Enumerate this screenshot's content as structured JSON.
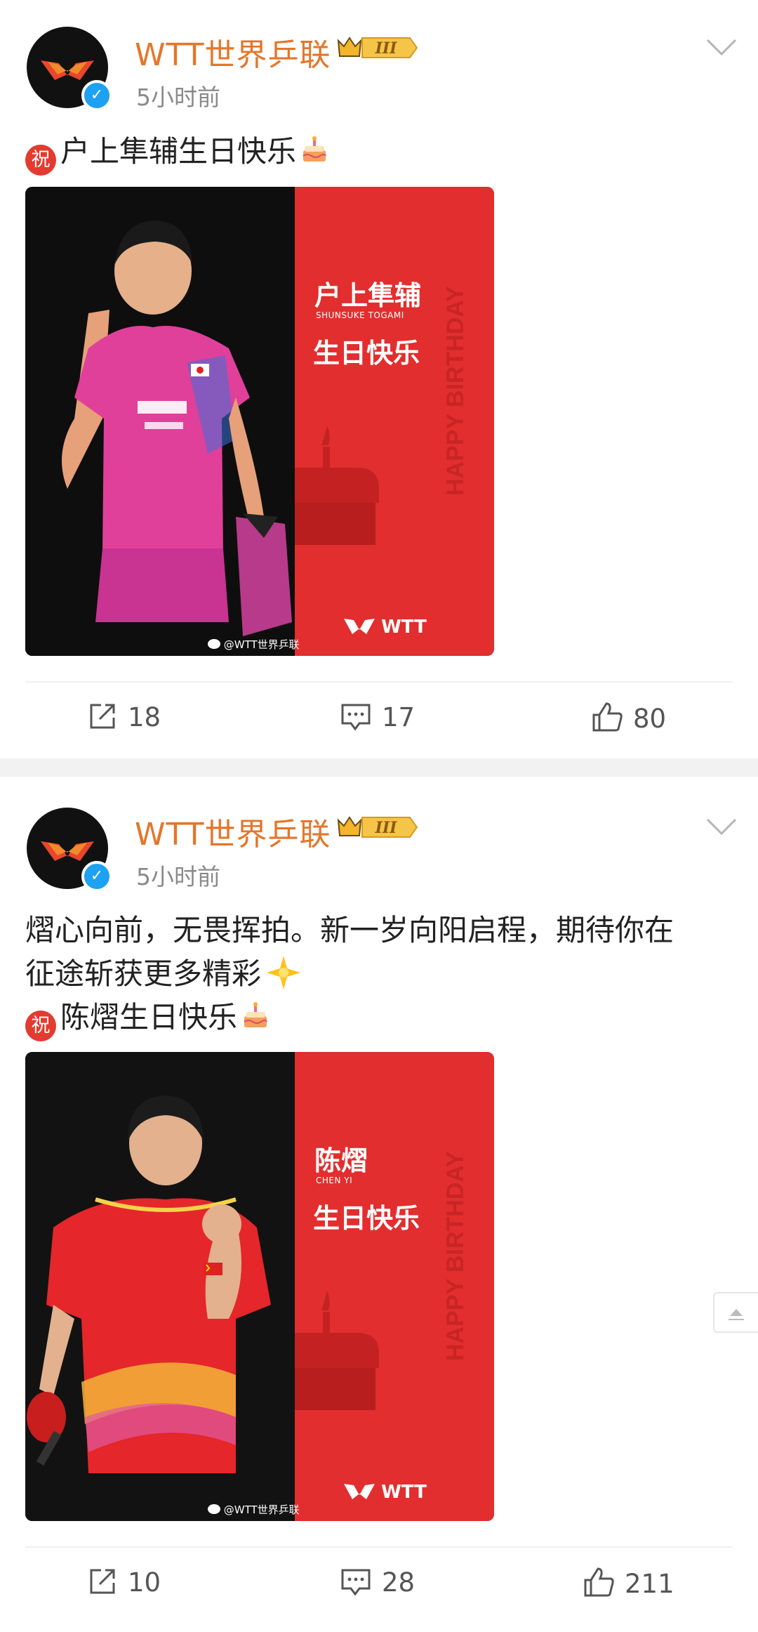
{
  "posts": [
    {
      "author": "WTT世界乒联",
      "time": "5小时前",
      "text_lines": [],
      "greeting_badge": "祝",
      "greeting": "户上隼辅生日快乐",
      "card": {
        "name_cn": "户上隼辅",
        "name_en": "SHUNSUKE TOGAMI",
        "birthday": "生日快乐",
        "logo": "WTT",
        "watermark": "@WTT世界乒联"
      },
      "actions": {
        "share": "18",
        "comment": "17",
        "like": "80"
      }
    },
    {
      "author": "WTT世界乒联",
      "time": "5小时前",
      "text_lines": [
        "熠心向前，无畏挥拍。新一岁向阳启程，期待你在",
        "征途斩获更多精彩"
      ],
      "greeting_badge": "祝",
      "greeting": "陈熠生日快乐",
      "card": {
        "name_cn": "陈熠",
        "name_en": "CHEN YI",
        "birthday": "生日快乐",
        "logo": "WTT",
        "watermark": "@WTT世界乒联"
      },
      "actions": {
        "share": "10",
        "comment": "28",
        "like": "211"
      }
    }
  ],
  "badge_level": "III",
  "happy_birthday_text": "HAPPY BIRTHDAY",
  "colors": {
    "author": "#e4762a",
    "card_red": "#e22e2e",
    "verified": "#1da1f2"
  }
}
